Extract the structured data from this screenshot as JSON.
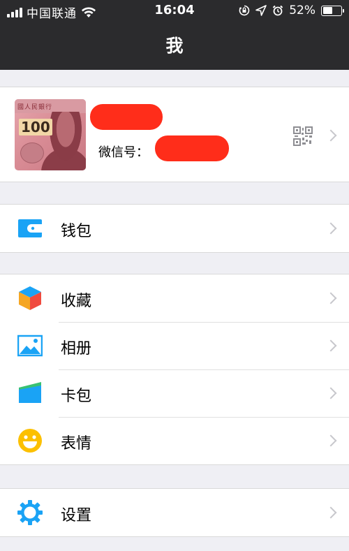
{
  "status_bar": {
    "carrier": "中国联通",
    "time": "16:04",
    "battery_percent": "52%",
    "battery_level": 0.52,
    "icons": [
      "signal-icon",
      "wifi-icon",
      "orientation-lock-icon",
      "location-icon",
      "alarm-icon",
      "battery-icon"
    ]
  },
  "nav": {
    "title": "我"
  },
  "profile": {
    "wechat_id_label": "微信号：",
    "icons": [
      "avatar-image",
      "qr-code-icon",
      "chevron-right-icon"
    ],
    "avatar_band_text": "國人民銀行",
    "avatar_denomination": "100"
  },
  "groups": [
    {
      "items": [
        {
          "label": "钱包",
          "icon": "wallet-icon",
          "color": "#1aa3f5"
        }
      ]
    },
    {
      "items": [
        {
          "label": "收藏",
          "icon": "favorites-cube-icon",
          "color": "#f5a623"
        },
        {
          "label": "相册",
          "icon": "album-photo-icon",
          "color": "#1aa3f5"
        },
        {
          "label": "卡包",
          "icon": "card-package-icon",
          "color": "#1aa3f5"
        },
        {
          "label": "表情",
          "icon": "sticker-smile-icon",
          "color": "#fcc000"
        }
      ]
    },
    {
      "items": [
        {
          "label": "设置",
          "icon": "settings-gear-icon",
          "color": "#1aa3f5"
        }
      ]
    }
  ],
  "colors": {
    "nav_background": "#2b2b2d",
    "page_background": "#efeff4",
    "redaction": "#ff2d1a",
    "chevron": "#c7c7cc"
  }
}
